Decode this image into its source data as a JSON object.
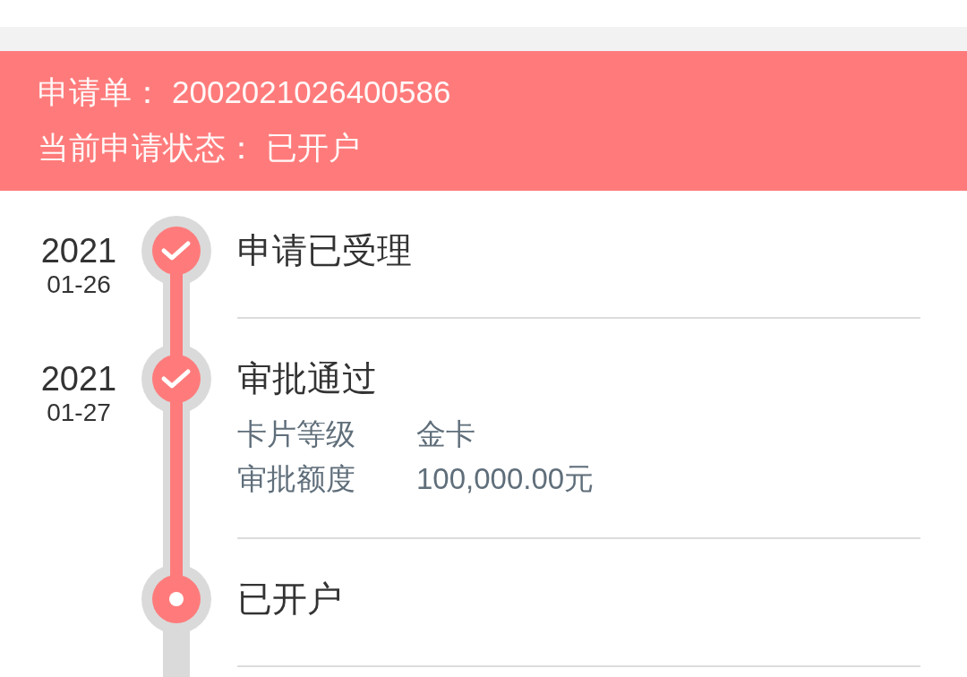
{
  "header": {
    "application_label": "申请单：",
    "application_number": "2002021026400586",
    "status_label": "当前申请状态：",
    "status_value": "已开户"
  },
  "steps": [
    {
      "year": "2021",
      "date": "01-26",
      "title": "申请已受理",
      "kind": "done"
    },
    {
      "year": "2021",
      "date": "01-27",
      "title": "审批通过",
      "kind": "done",
      "details": [
        {
          "label": "卡片等级",
          "value": "金卡"
        },
        {
          "label": "审批额度",
          "value": "100,000.00元"
        }
      ]
    },
    {
      "title": "已开户",
      "kind": "current"
    }
  ]
}
